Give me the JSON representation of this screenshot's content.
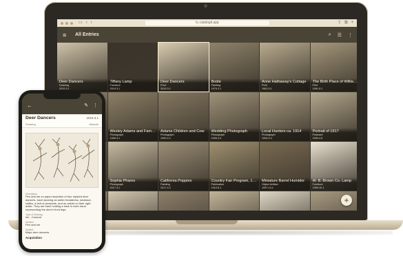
{
  "browser": {
    "url": "tc.catalogit.app"
  },
  "app": {
    "title": "All Entries"
  },
  "entries": [
    {
      "title": "Deer Dancers",
      "type": "Drawing",
      "date": "2019.3.1",
      "tone": "#cfc3a9"
    },
    {
      "title": "Tiffany Lamp",
      "type": "Furniture",
      "date": "2019.3.1",
      "tone": "#3b342a"
    },
    {
      "title": "Deer Dancers",
      "type": "Print",
      "date": "2019.3.1",
      "tone": "#d8ccb1"
    },
    {
      "title": "Bodie",
      "type": "Painting",
      "date": "1979.3.1",
      "tone": "#8e826a"
    },
    {
      "title": "Anne Hathaway's Cottage",
      "type": "Print",
      "date": "1961.5.1",
      "tone": "#b8ab8f"
    },
    {
      "title": "The Birth Place of William S...",
      "type": "Print",
      "date": "1961.5.1",
      "tone": "#a5987c"
    },
    {
      "title": "",
      "type": "",
      "date": "",
      "tone": "#988b72"
    },
    {
      "title": "Wesley Adams and Family o...",
      "type": "Photograph",
      "date": "1999.4.1",
      "tone": "#8c7f66"
    },
    {
      "title": "Adams Children and Cow",
      "type": "Photograph",
      "date": "1999.4.2",
      "tone": "#857862"
    },
    {
      "title": "Wedding Photograph",
      "type": "Photograph",
      "date": "1999.4.3",
      "tone": "#9e9279"
    },
    {
      "title": "Local Hunters ca. 1914",
      "type": "Photograph",
      "date": "1999.4.4",
      "tone": "#a99c82"
    },
    {
      "title": "Portrait of 1917",
      "type": "Postcard",
      "date": "1999.4.5",
      "tone": "#b3a78d"
    },
    {
      "title": "",
      "type": "",
      "date": "",
      "tone": "#6f6452"
    },
    {
      "title": "Sophia Phares",
      "type": "Photograph",
      "date": "2017.4.1",
      "tone": "#c7bba2"
    },
    {
      "title": "California Poppies",
      "type": "Painting",
      "date": "2017.4.2",
      "tone": "#9c8f77"
    },
    {
      "title": "Country Fair Program, 1910",
      "type": "Publication",
      "date": "1910.5.1",
      "tone": "#9f906f"
    },
    {
      "title": "Miniature Barrel Humidor",
      "type": "Object Artifact",
      "date": "1997.14.1",
      "tone": "#7a6a52"
    },
    {
      "title": "W. B. Brown Co. Lamp",
      "type": "Furniture",
      "date": "1999.10.1",
      "tone": "#e8e0cf"
    },
    {
      "title": "",
      "type": "",
      "date": "",
      "tone": "#b0a48b"
    },
    {
      "title": "",
      "type": "",
      "date": "",
      "tone": "#d2c7b0"
    },
    {
      "title": "",
      "type": "",
      "date": "",
      "tone": "#8d806a"
    },
    {
      "title": "",
      "type": "",
      "date": "",
      "tone": "#c0b499"
    },
    {
      "title": "",
      "type": "",
      "date": "",
      "tone": "#ded6c5"
    },
    {
      "title": "",
      "type": "",
      "date": "",
      "tone": "#a89b82"
    }
  ],
  "phone": {
    "title": "Deer Dancers",
    "date": "2019.3.1",
    "type": "Drawing",
    "artwork": "Artwork",
    "description_label": "Description",
    "description": "Pen and ink on paper depiction of four stylized deer dancers, each wearing an antler headdress, necklace, rattles, a belt of pendants, and an anklet on their right ankle. They are each holding a stick in each hand representing the deer's front legs.",
    "drawing_type_label": "Type of Drawing",
    "drawing_type": "Ink - Colored",
    "medium_label": "Medium",
    "medium": "Pen and ink",
    "subject_label": "Subject",
    "subject": "Mayo deer dancers",
    "acquisition_label": "Acquisition"
  }
}
